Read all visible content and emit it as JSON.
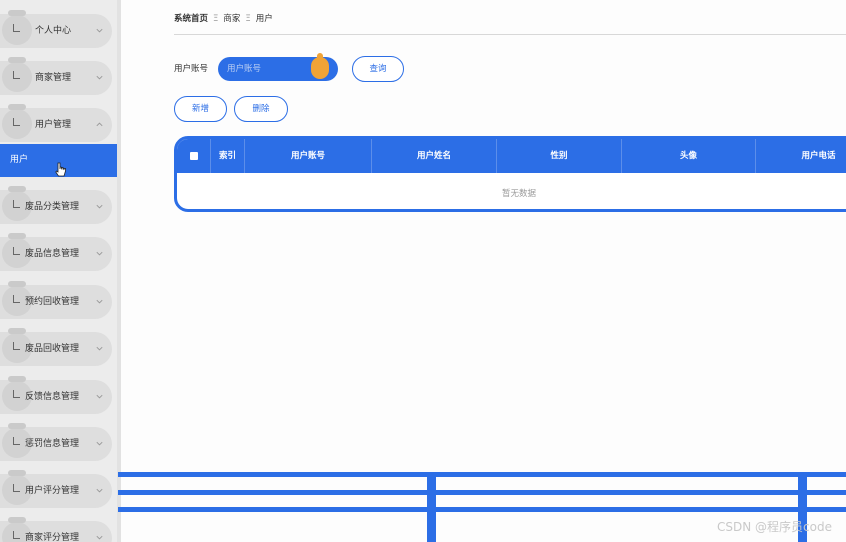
{
  "sidebar": {
    "items": [
      {
        "label": "个人中心",
        "expanded": false
      },
      {
        "label": "商家管理",
        "expanded": false
      },
      {
        "label": "用户管理",
        "expanded": true
      },
      {
        "label": "废品分类管理",
        "expanded": false
      },
      {
        "label": "废品信息管理",
        "expanded": false
      },
      {
        "label": "预约回收管理",
        "expanded": false
      },
      {
        "label": "废品回收管理",
        "expanded": false
      },
      {
        "label": "反馈信息管理",
        "expanded": false
      },
      {
        "label": "惩罚信息管理",
        "expanded": false
      },
      {
        "label": "用户评分管理",
        "expanded": false
      },
      {
        "label": "商家评分管理",
        "expanded": false
      }
    ],
    "active_subitem": "用户"
  },
  "breadcrumb": {
    "items": [
      "系统首页",
      "商家",
      "用户"
    ],
    "separator": "Ξ"
  },
  "search": {
    "label": "用户账号",
    "placeholder": "用户账号",
    "value": "",
    "query_button": "查询"
  },
  "actions": {
    "add_button": "新增",
    "delete_button": "删除"
  },
  "table": {
    "columns": [
      "索引",
      "用户账号",
      "用户姓名",
      "性别",
      "头像",
      "用户电话"
    ],
    "rows": [],
    "empty_text": "暂无数据"
  },
  "watermark": "CSDN @程序员code",
  "colors": {
    "accent": "#2c6ee6",
    "knob": "#f0a336",
    "sidebar_bg": "#ececec"
  }
}
